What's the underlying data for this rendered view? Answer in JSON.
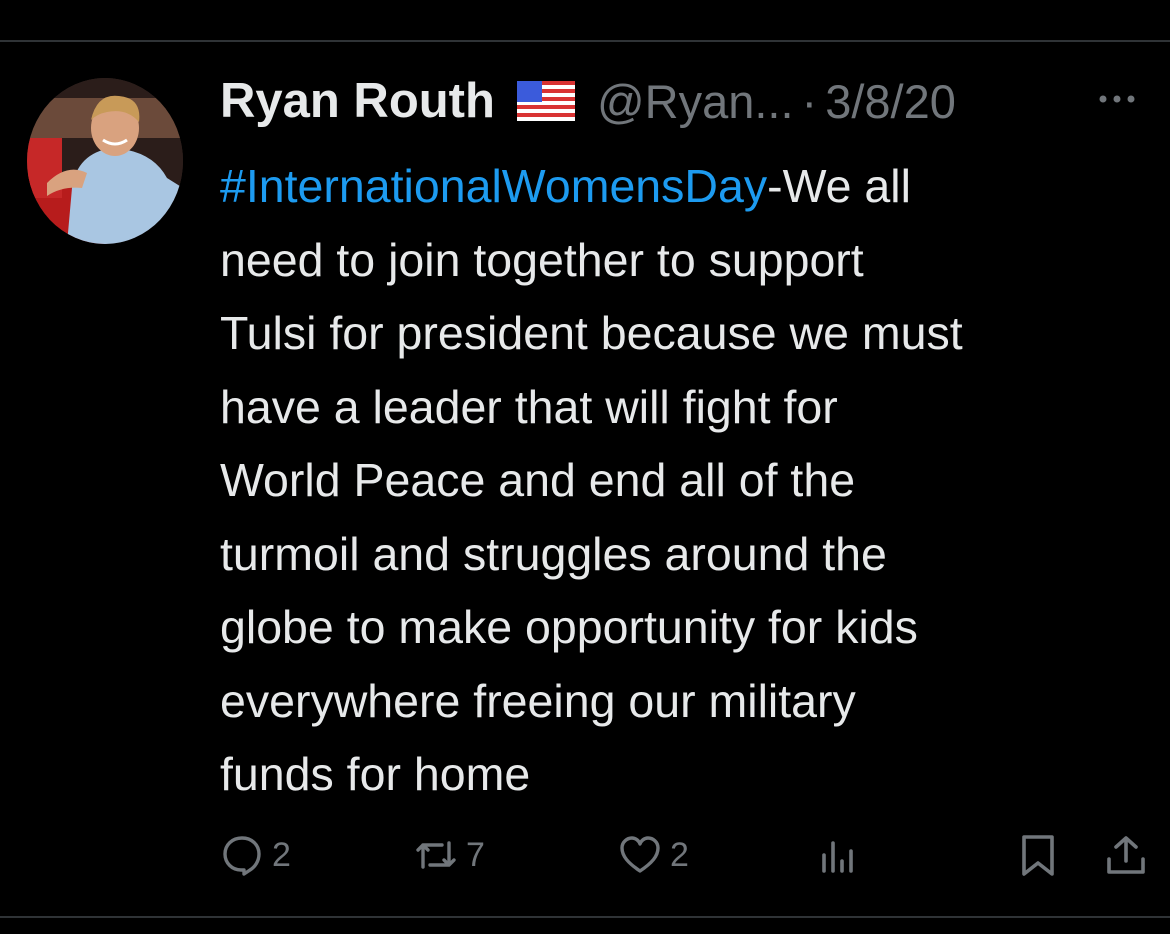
{
  "post": {
    "author_name": "Ryan Routh",
    "author_flag": "us-flag-icon",
    "handle": "@Ryan...",
    "separator": "·",
    "date": "3/8/20",
    "hashtag": "#InternationalWomensDay",
    "body_text": "-We all\nneed to join together to support\nTulsi for president because we must\nhave a leader that will fight for\nWorld Peace and end all of the\nturmoil and struggles around the\nglobe to make opportunity for kids\neverywhere freeing our military\nfunds for home"
  },
  "actions": {
    "replies": "2",
    "reposts": "7",
    "likes": "2"
  },
  "colors": {
    "background": "#000000",
    "text": "#e7e9ea",
    "muted": "#71767b",
    "link": "#1d9bf0",
    "divider": "#2f3336"
  }
}
